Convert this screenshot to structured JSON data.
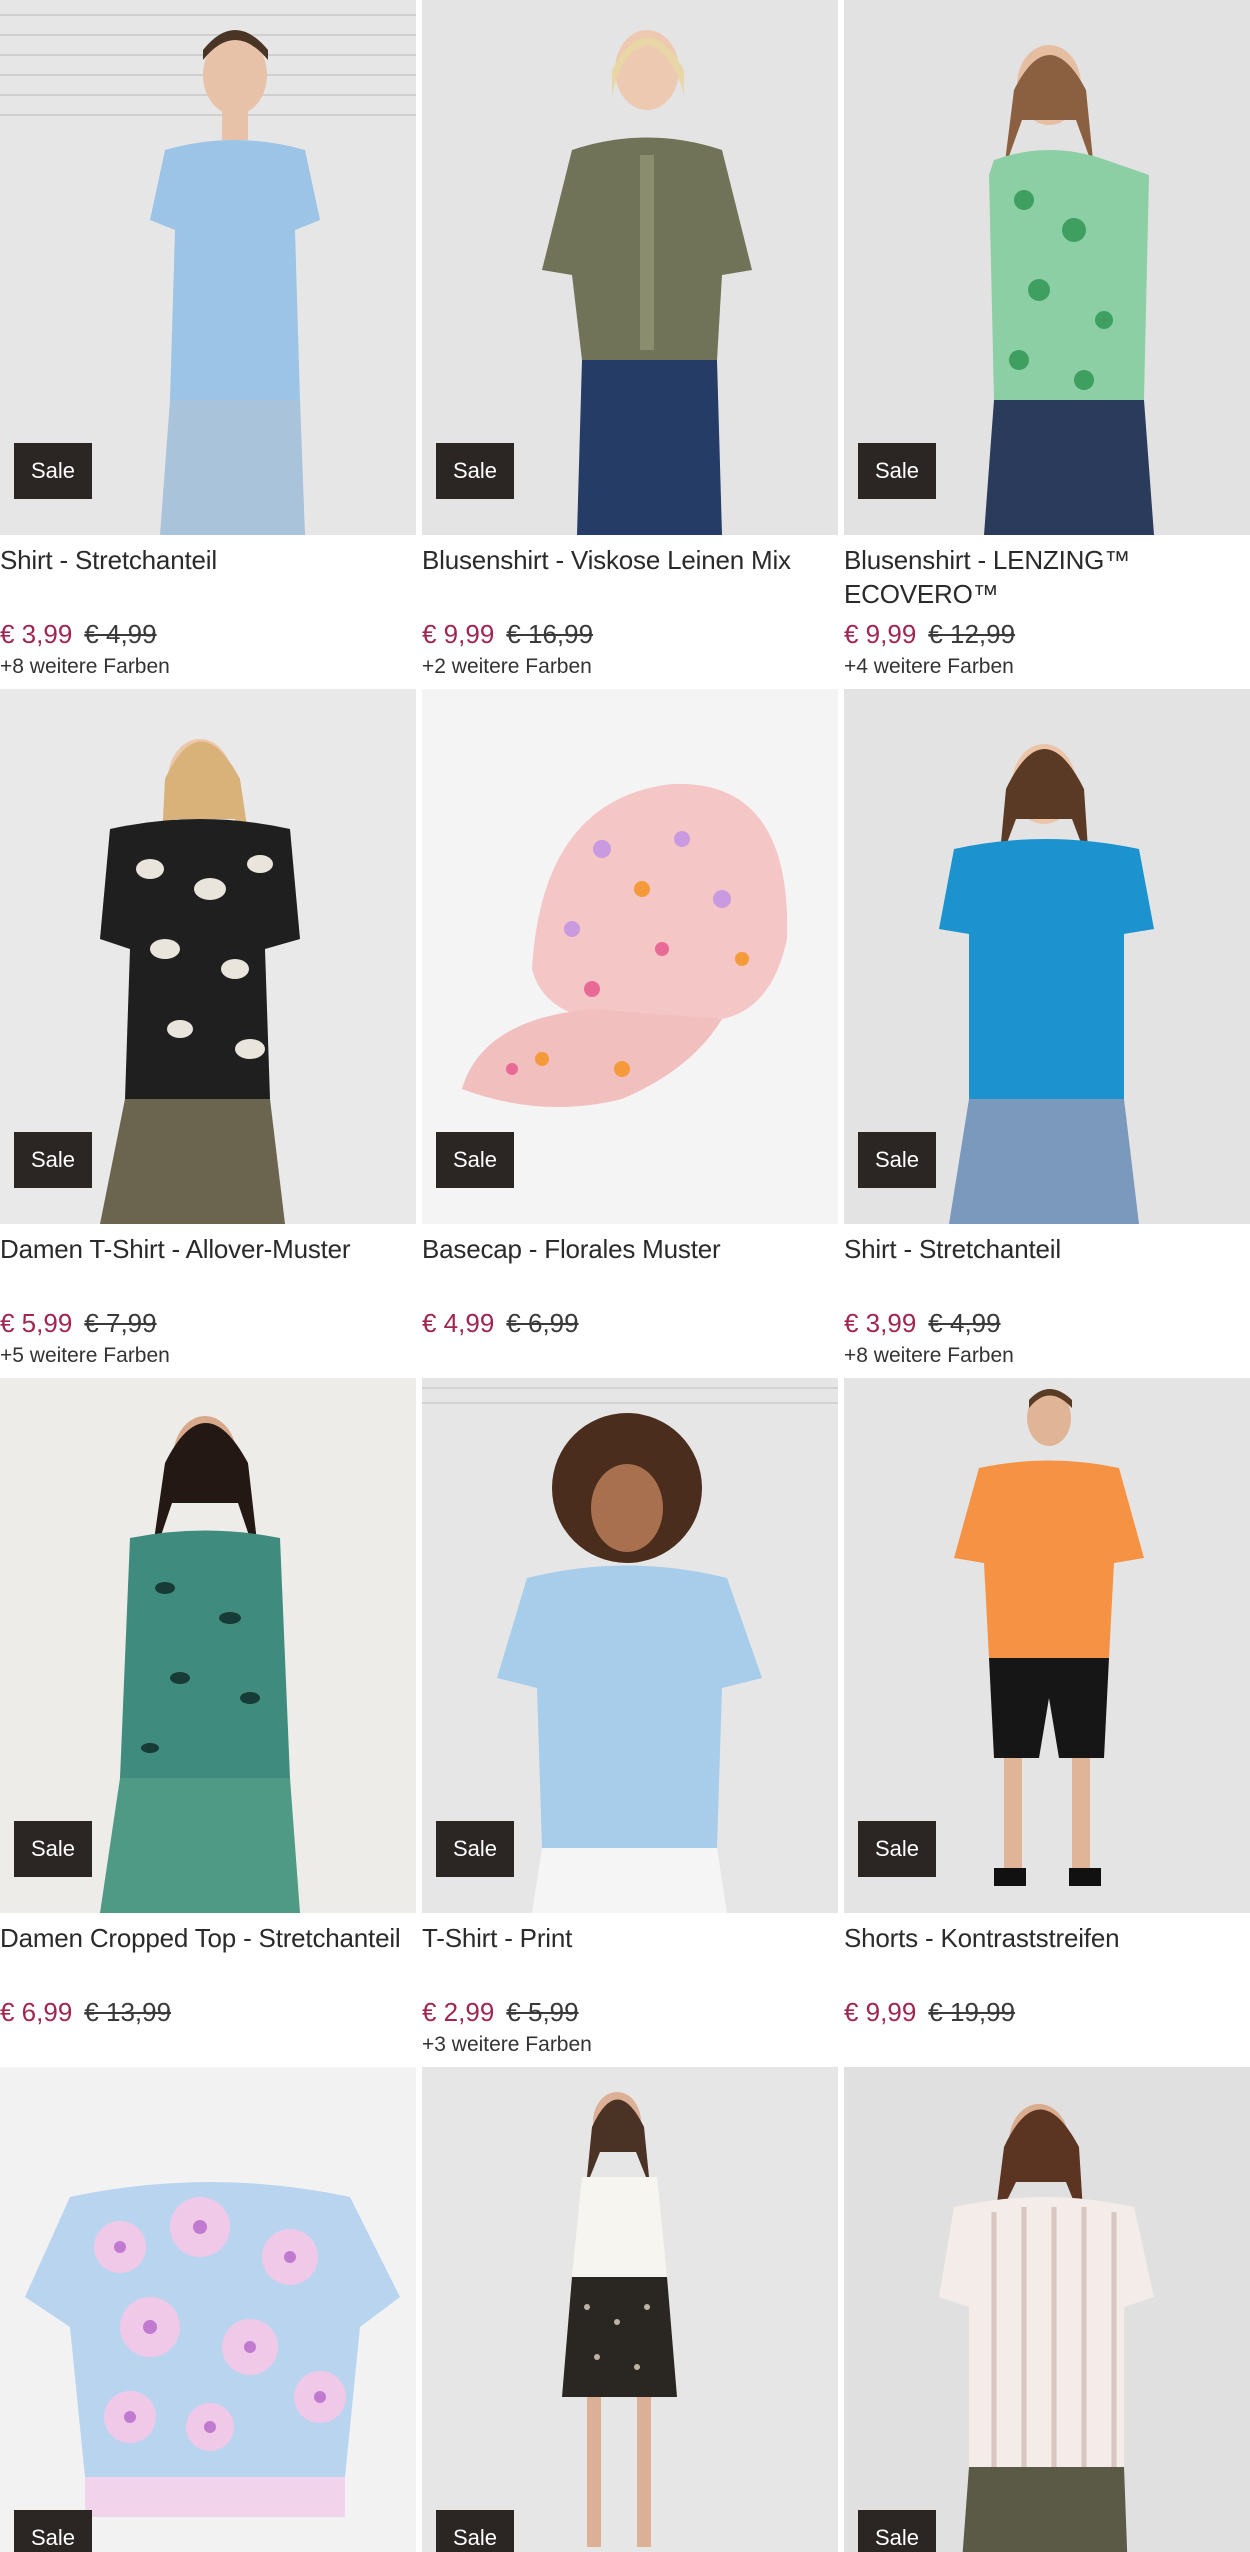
{
  "products": [
    {
      "title": "Shirt - Stretchanteil",
      "badge": "Sale",
      "price_new": "€ 3,99",
      "price_old": "€ 4,99",
      "colors": "+8 weitere Farben"
    },
    {
      "title": "Blusenshirt - Viskose Leinen Mix",
      "badge": "Sale",
      "price_new": "€ 9,99",
      "price_old": "€ 16,99",
      "colors": "+2 weitere Farben"
    },
    {
      "title": "Blusenshirt - LENZING™ ECOVERO™",
      "badge": "Sale",
      "price_new": "€ 9,99",
      "price_old": "€ 12,99",
      "colors": "+4 weitere Farben"
    },
    {
      "title": "Damen T-Shirt - Allover-Muster",
      "badge": "Sale",
      "price_new": "€ 5,99",
      "price_old": "€ 7,99",
      "colors": "+5 weitere Farben"
    },
    {
      "title": "Basecap - Florales Muster",
      "badge": "Sale",
      "price_new": "€ 4,99",
      "price_old": "€ 6,99",
      "colors": ""
    },
    {
      "title": "Shirt - Stretchanteil",
      "badge": "Sale",
      "price_new": "€ 3,99",
      "price_old": "€ 4,99",
      "colors": "+8 weitere Farben"
    },
    {
      "title": "Damen Cropped Top - Stretchanteil",
      "badge": "Sale",
      "price_new": "€ 6,99",
      "price_old": "€ 13,99",
      "colors": ""
    },
    {
      "title": "T-Shirt - Print",
      "badge": "Sale",
      "price_new": "€ 2,99",
      "price_old": "€ 5,99",
      "colors": "+3 weitere Farben"
    },
    {
      "title": "Shorts - Kontraststreifen",
      "badge": "Sale",
      "price_new": "€ 9,99",
      "price_old": "€ 19,99",
      "colors": ""
    },
    {
      "badge": "Sale"
    },
    {
      "badge": "Sale"
    },
    {
      "badge": "Sale"
    }
  ],
  "colors": {
    "sale_price": "#a0264f",
    "badge_bg": "#2b2523",
    "text": "#2a2a2a"
  }
}
